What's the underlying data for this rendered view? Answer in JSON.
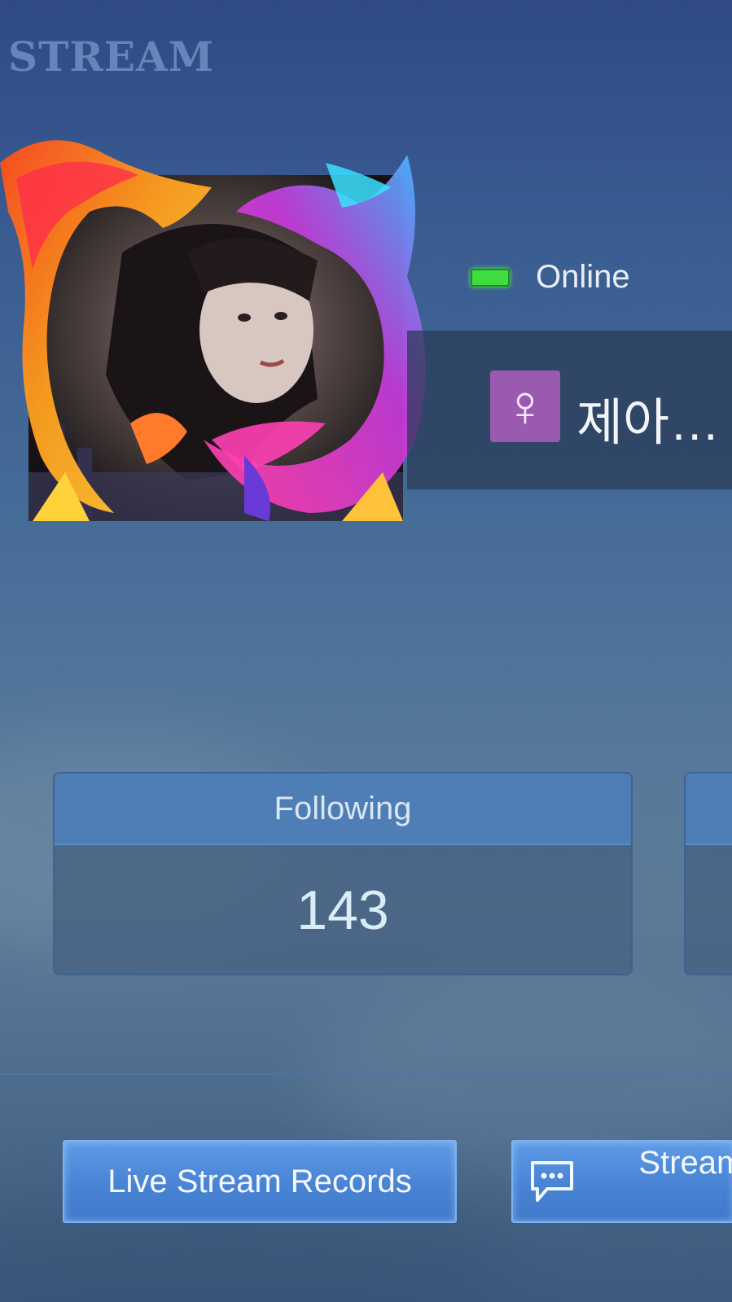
{
  "header": {
    "title": "STREAM"
  },
  "profile": {
    "status": "Online",
    "status_color": "#3fdc3f",
    "gender_symbol": "♀",
    "gender_color": "#9a5ab0",
    "name": "제아…"
  },
  "stats": {
    "following": {
      "label": "Following",
      "value": "143"
    }
  },
  "buttons": {
    "live_stream_records": "Live Stream Records",
    "stream_chat_partial": "Stream Ch"
  },
  "icons": {
    "chat": "chat-bubble-icon"
  }
}
